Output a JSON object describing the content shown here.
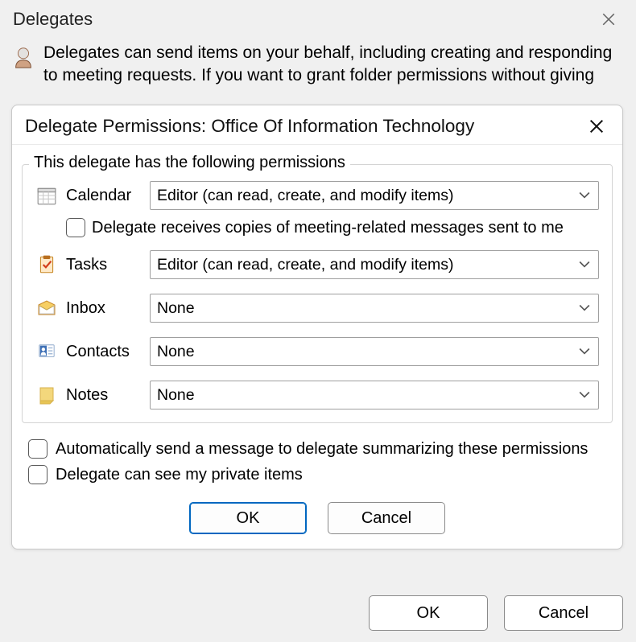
{
  "outer": {
    "title": "Delegates",
    "description": "Delegates can send items on your behalf, including creating and responding to meeting requests. If you want to grant folder permissions without giving",
    "ok_label": "OK",
    "cancel_label": "Cancel"
  },
  "inner": {
    "title": "Delegate Permissions: Office Of Information Technology",
    "group_legend": "This delegate has the following permissions",
    "rows": {
      "calendar": {
        "label": "Calendar",
        "value": "Editor (can read, create, and modify items)"
      },
      "tasks": {
        "label": "Tasks",
        "value": "Editor (can read, create, and modify items)"
      },
      "inbox": {
        "label": "Inbox",
        "value": "None"
      },
      "contacts": {
        "label": "Contacts",
        "value": "None"
      },
      "notes": {
        "label": "Notes",
        "value": "None"
      }
    },
    "meeting_copies_label": "Delegate receives copies of meeting-related messages sent to me",
    "checkboxes": {
      "auto_summary": "Automatically send a message to delegate summarizing these permissions",
      "private_items": "Delegate can see my private items"
    },
    "ok_label": "OK",
    "cancel_label": "Cancel"
  }
}
